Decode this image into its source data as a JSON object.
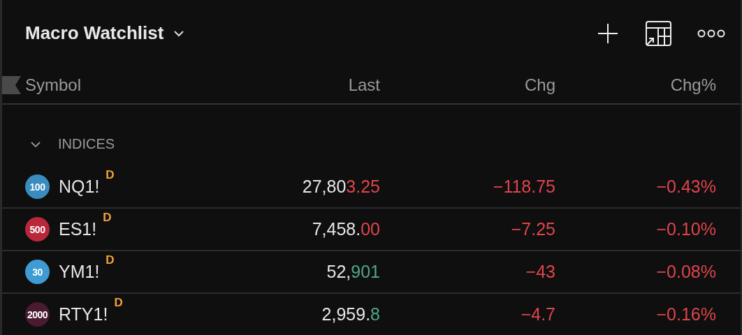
{
  "watchlist": {
    "title": "Macro Watchlist"
  },
  "columns": [
    "Symbol",
    "Last",
    "Chg",
    "Chg%"
  ],
  "group": {
    "label": "INDICES",
    "expanded": true
  },
  "rows": [
    {
      "badge": {
        "text": "100",
        "color": "#3a8cc0"
      },
      "symbol": "NQ1!",
      "flag": "D",
      "last": {
        "unchanged": "27,80",
        "changed": "3.25",
        "up": false
      },
      "chg": "−118.75",
      "chg_pct": "−0.43%",
      "up": false
    },
    {
      "badge": {
        "text": "500",
        "color": "#b8283a"
      },
      "symbol": "ES1!",
      "flag": "D",
      "last": {
        "unchanged": "7,458.",
        "changed": "00",
        "up": false
      },
      "chg": "−7.25",
      "chg_pct": "−0.10%",
      "up": false
    },
    {
      "badge": {
        "text": "30",
        "color": "#3f9bd4"
      },
      "symbol": "YM1!",
      "flag": "D",
      "last": {
        "unchanged": "52,",
        "changed": "901",
        "up": true
      },
      "chg": "−43",
      "chg_pct": "−0.08%",
      "up": false
    },
    {
      "badge": {
        "text": "2000",
        "color": "#4a1a30"
      },
      "symbol": "RTY1!",
      "flag": "D",
      "last": {
        "unchanged": "2,959.",
        "changed": "8",
        "up": true
      },
      "chg": "−4.7",
      "chg_pct": "−0.16%",
      "up": false
    }
  ]
}
